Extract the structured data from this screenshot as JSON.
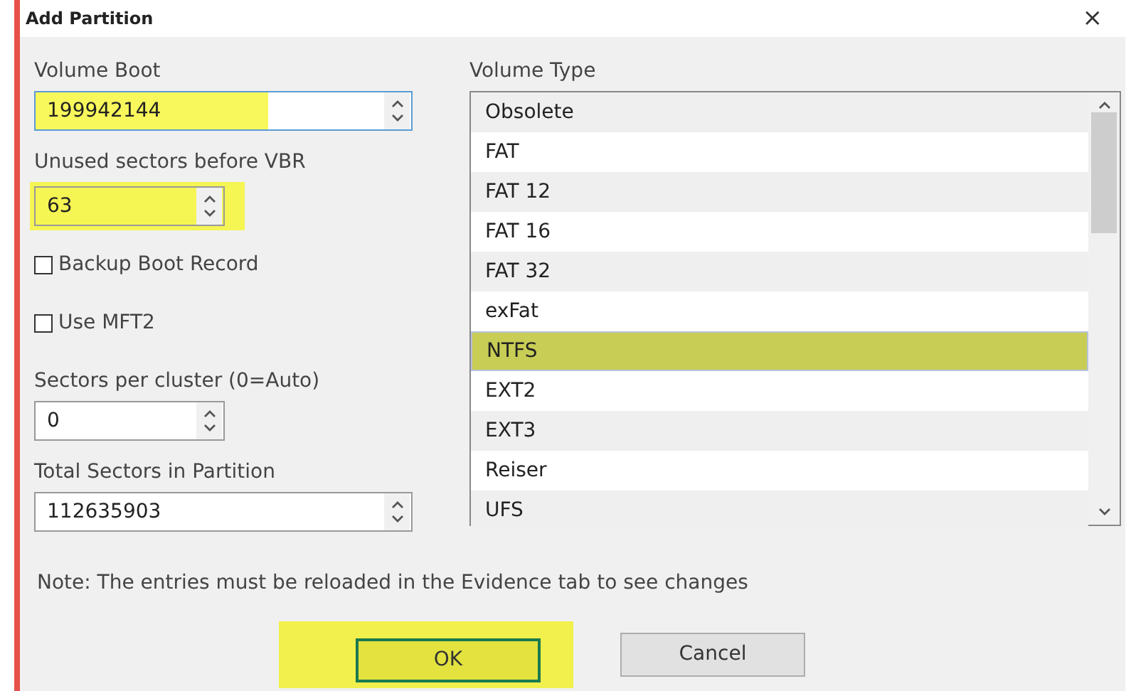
{
  "window": {
    "title": "Add Partition",
    "close": "×"
  },
  "fields": [
    {
      "label": "Volume Boot",
      "value": "199942144",
      "wide": true,
      "highlighted": true
    },
    {
      "label": "Unused sectors before VBR",
      "value": "63",
      "wide": false,
      "highlighted": true
    },
    {
      "kind": "checkbox",
      "label": "Backup Boot Record",
      "checked": false
    },
    {
      "kind": "checkbox",
      "label": "Use MFT2",
      "checked": false
    },
    {
      "label": "Sectors per cluster (0=Auto)",
      "value": "0",
      "wide": false,
      "highlighted": false
    },
    {
      "label": "Total Sectors in Partition",
      "value": "112635903",
      "wide": true,
      "highlighted": false
    }
  ],
  "volume_type": {
    "label": "Volume Type",
    "items": [
      {
        "label": "Obsolete",
        "selected": false
      },
      {
        "label": "FAT",
        "selected": false
      },
      {
        "label": "FAT 12",
        "selected": false
      },
      {
        "label": "FAT 16",
        "selected": false
      },
      {
        "label": "FAT 32",
        "selected": false
      },
      {
        "label": "exFat",
        "selected": false
      },
      {
        "label": "NTFS",
        "selected": true
      },
      {
        "label": "EXT2",
        "selected": false
      },
      {
        "label": "EXT3",
        "selected": false
      },
      {
        "label": "Reiser",
        "selected": false
      },
      {
        "label": "UFS",
        "selected": false
      }
    ]
  },
  "note": "Note: The entries must be reloaded in the Evidence tab to see changes",
  "buttons": [
    {
      "label": "OK",
      "default": true,
      "highlighted": true
    },
    {
      "label": "Cancel",
      "default": false,
      "highlighted": false
    }
  ]
}
